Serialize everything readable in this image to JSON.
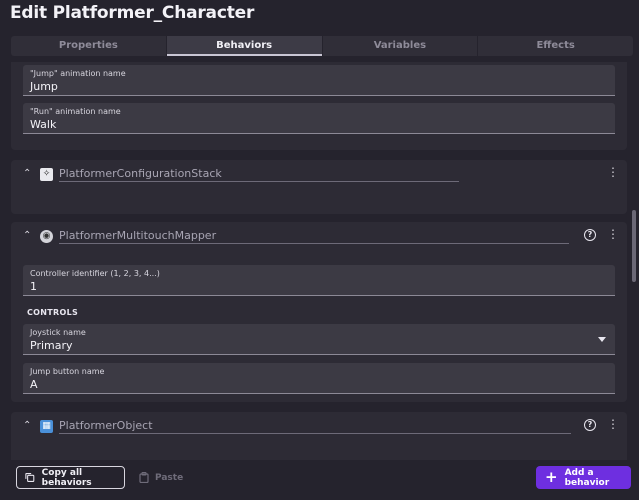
{
  "window": {
    "title": "Edit Platformer_Character"
  },
  "tabs": [
    {
      "label": "Properties"
    },
    {
      "label": "Behaviors"
    },
    {
      "label": "Variables"
    },
    {
      "label": "Effects"
    }
  ],
  "card0": {
    "jump_anim": {
      "label": "\"Jump\" animation name",
      "value": "Jump"
    },
    "run_anim": {
      "label": "\"Run\" animation name",
      "value": "Walk"
    }
  },
  "behaviors": [
    {
      "name": "PlatformerConfigurationStack",
      "icon": "running-figure-icon"
    },
    {
      "name": "PlatformerMultitouchMapper",
      "icon": "controller-icon",
      "controller_id": {
        "label": "Controller identifier (1, 2, 3, 4...)",
        "value": "1"
      },
      "section": "CONTROLS",
      "joystick": {
        "label": "Joystick name",
        "value": "Primary"
      },
      "jump_button": {
        "label": "Jump button name",
        "value": "A"
      }
    },
    {
      "name": "PlatformerObject",
      "icon": "platformer-object-icon"
    }
  ],
  "footer": {
    "copy_label": "Copy all behaviors",
    "paste_label": "Paste",
    "add_label": "Add a behavior"
  },
  "colors": {
    "accent": "#6e2fe0",
    "background": "#25232d",
    "card": "#2d2b35"
  }
}
